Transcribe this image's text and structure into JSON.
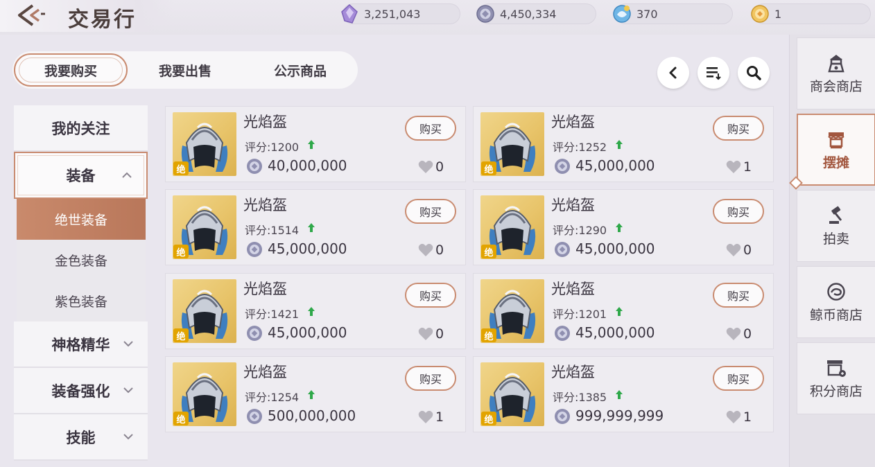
{
  "header": {
    "title": "交易行",
    "currencies": [
      {
        "icon": "purple-crystal-icon",
        "value": "3,251,043"
      },
      {
        "icon": "silver-coin-icon",
        "value": "4,450,334"
      },
      {
        "icon": "blue-ticket-icon",
        "value": "370"
      },
      {
        "icon": "gold-token-icon",
        "value": "1"
      }
    ]
  },
  "tabs": [
    "我要购买",
    "我要出售",
    "公示商品"
  ],
  "leftmenu": {
    "follow": "我的关注",
    "equip": "装备",
    "sub": [
      "绝世装备",
      "金色装备",
      "紫色装备"
    ],
    "divine": "神格精华",
    "enhance": "装备强化",
    "skill": "技能"
  },
  "items": [
    {
      "name": "光焰盔",
      "tag": "绝",
      "score": "评分:1200",
      "price": "40,000,000",
      "likes": "0",
      "buy": "购买"
    },
    {
      "name": "光焰盔",
      "tag": "绝",
      "score": "评分:1252",
      "price": "45,000,000",
      "likes": "1",
      "buy": "购买"
    },
    {
      "name": "光焰盔",
      "tag": "绝",
      "score": "评分:1514",
      "price": "45,000,000",
      "likes": "0",
      "buy": "购买"
    },
    {
      "name": "光焰盔",
      "tag": "绝",
      "score": "评分:1290",
      "price": "45,000,000",
      "likes": "0",
      "buy": "购买"
    },
    {
      "name": "光焰盔",
      "tag": "绝",
      "score": "评分:1421",
      "price": "45,000,000",
      "likes": "0",
      "buy": "购买"
    },
    {
      "name": "光焰盔",
      "tag": "绝",
      "score": "评分:1201",
      "price": "45,000,000",
      "likes": "0",
      "buy": "购买"
    },
    {
      "name": "光焰盔",
      "tag": "绝",
      "score": "评分:1254",
      "price": "500,000,000",
      "likes": "1",
      "buy": "购买"
    },
    {
      "name": "光焰盔",
      "tag": "绝",
      "score": "评分:1385",
      "price": "999,999,999",
      "likes": "1",
      "buy": "购买"
    }
  ],
  "rightnav": [
    {
      "label": "商会商店",
      "icon": "guild-shop-icon"
    },
    {
      "label": "摆摊",
      "icon": "stall-icon"
    },
    {
      "label": "拍卖",
      "icon": "auction-gavel-icon"
    },
    {
      "label": "鲸币商店",
      "icon": "whale-coin-shop-icon"
    },
    {
      "label": "积分商店",
      "icon": "points-shop-icon"
    }
  ],
  "colors": {
    "accent": "#c98b70",
    "active_sub": "#c08062",
    "up_arrow": "#2fa84a"
  }
}
